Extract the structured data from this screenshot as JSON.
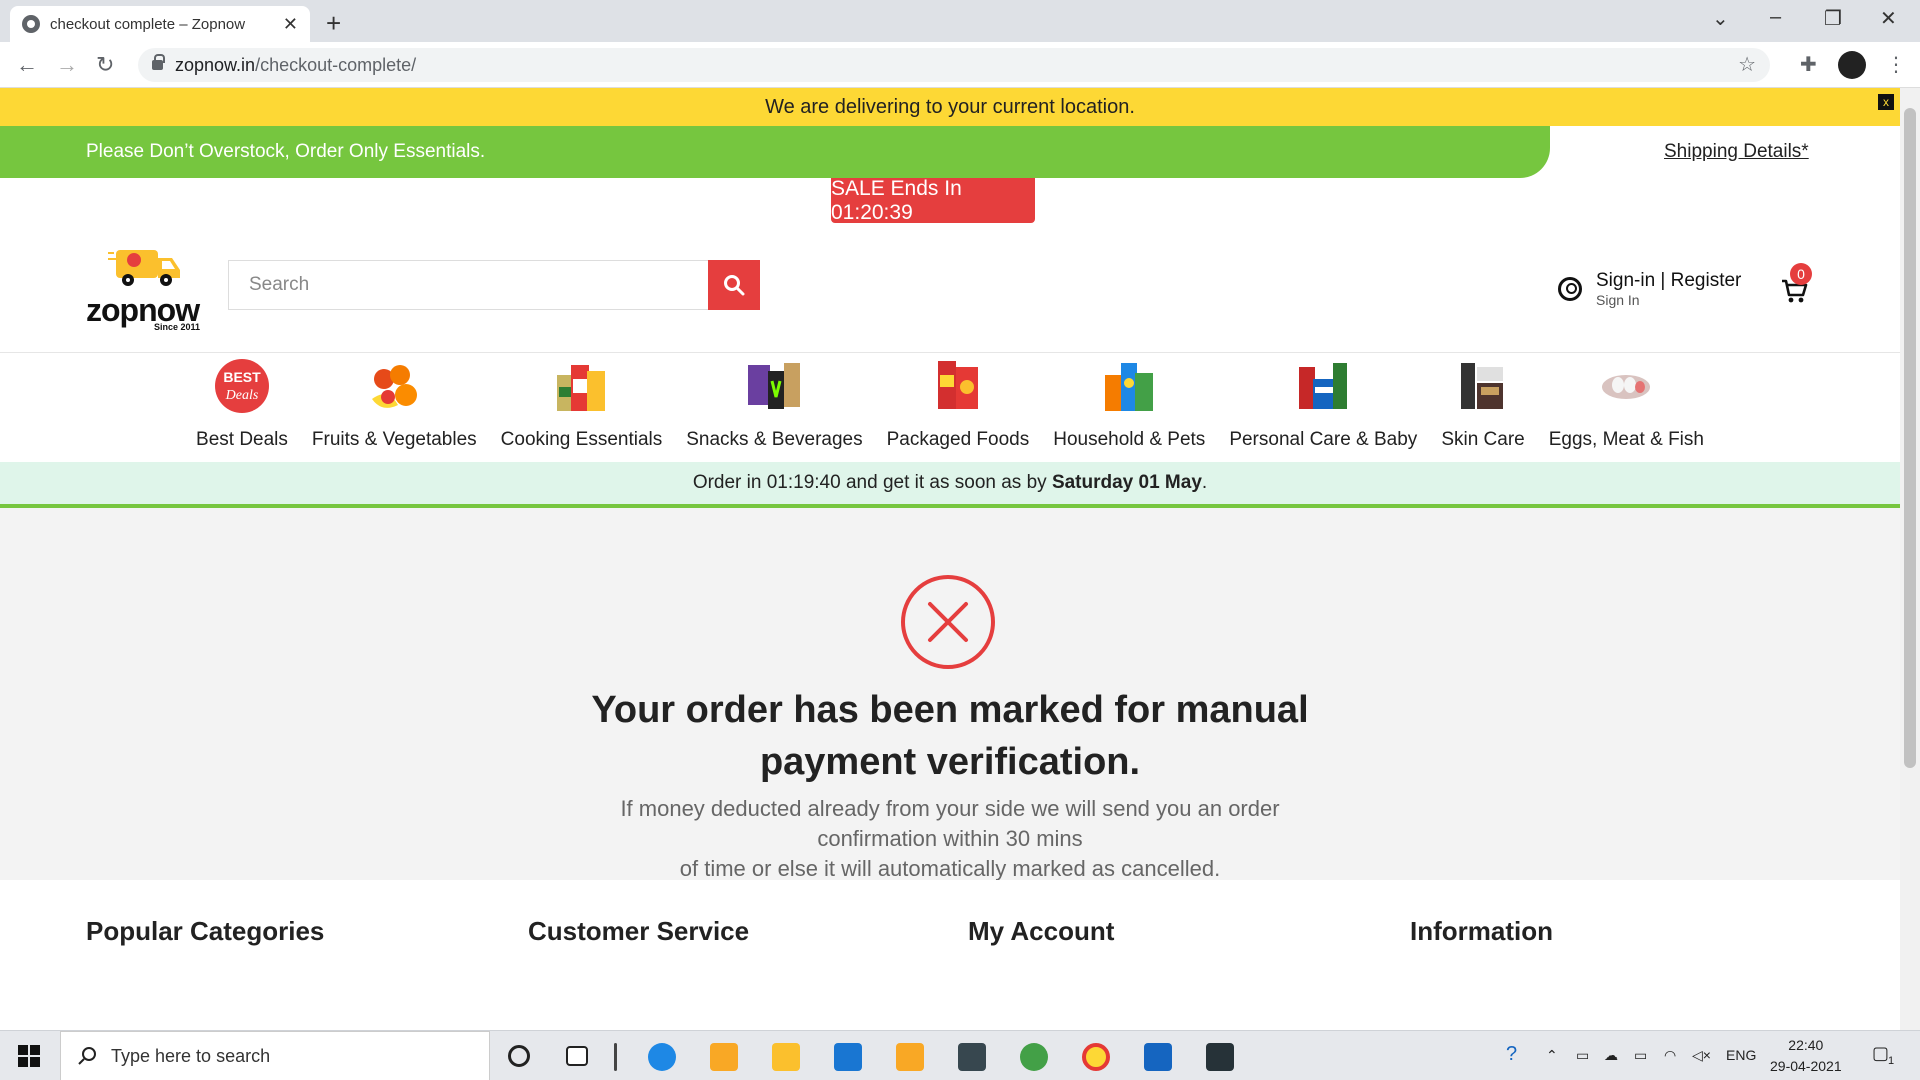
{
  "browser": {
    "tab_title": "checkout complete – Zopnow",
    "url_host": "zopnow.in",
    "url_path": "/checkout-complete/"
  },
  "banners": {
    "location": "We are delivering to your current location.",
    "close_label": "x",
    "essentials": "Please Don’t Overstock, Order Only Essentials.",
    "shipping_link": "Shipping Details*",
    "sale": "SALE Ends In 01:20:39"
  },
  "header": {
    "logo_text": "zopnow",
    "logo_since": "Since 2011",
    "search_placeholder": "Search",
    "signin_label": "Sign-in | Register",
    "signin_sub": "Sign In",
    "cart_count": "0"
  },
  "categories": [
    {
      "label": "Best Deals",
      "icon": "best-deals-icon",
      "color": "#e53e3e"
    },
    {
      "label": "Fruits & Vegetables",
      "icon": "fruits-icon",
      "color": "#f57c00"
    },
    {
      "label": "Cooking Essentials",
      "icon": "cooking-icon",
      "color": "#c8b560"
    },
    {
      "label": "Snacks & Beverages",
      "icon": "snacks-icon",
      "color": "#6a3fa0"
    },
    {
      "label": "Packaged Foods",
      "icon": "packaged-icon",
      "color": "#d32f2f"
    },
    {
      "label": "Household & Pets",
      "icon": "household-icon",
      "color": "#1e88e5"
    },
    {
      "label": "Personal Care & Baby",
      "icon": "personal-care-icon",
      "color": "#2e7d32"
    },
    {
      "label": "Skin Care",
      "icon": "skin-care-icon",
      "color": "#333333"
    },
    {
      "label": "Eggs, Meat & Fish",
      "icon": "eggs-icon",
      "color": "#d9c3c0"
    }
  ],
  "delivery": {
    "prefix": "Order in 01:19:40 and get it as soon as by ",
    "date": "Saturday 01 May",
    "suffix": "."
  },
  "result": {
    "headline_1": "Your order has been marked for manual",
    "headline_2": "payment verification.",
    "message_1": "If money deducted already from your side we will send you an order",
    "message_2": "confirmation within 30 mins",
    "message_3": "of time or else it will automatically marked as cancelled."
  },
  "footer": {
    "col1": "Popular Categories",
    "col2": "Customer Service",
    "col3": "My Account",
    "col4": "Information"
  },
  "taskbar": {
    "search_placeholder": "Type here to search",
    "lang": "ENG",
    "time": "22:40",
    "date": "29-04-2021",
    "notif_count": "1"
  },
  "colors": {
    "brand_red": "#e53e3e",
    "brand_green": "#76c63f",
    "banner_yellow": "#fdd835"
  }
}
